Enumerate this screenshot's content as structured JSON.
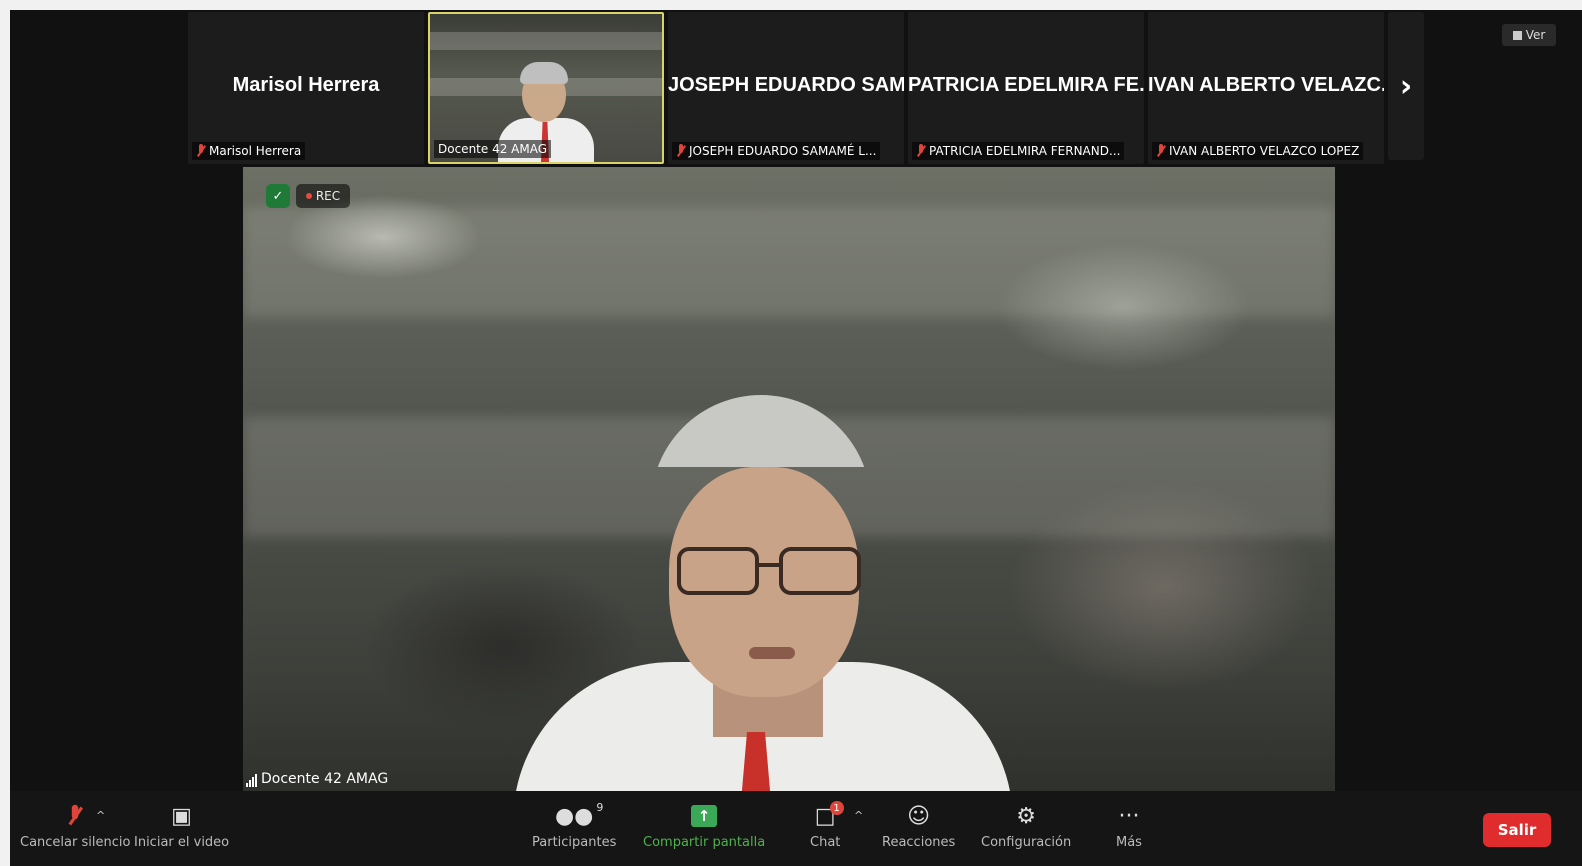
{
  "participants_strip": [
    {
      "display_name": "Marisol Herrera",
      "label": "Marisol Herrera",
      "has_video": false
    },
    {
      "display_name": "",
      "label": "Docente 42 AMAG",
      "has_video": true,
      "active_speaker": true
    },
    {
      "display_name": "JOSEPH EDUARDO SAM...",
      "label": "JOSEPH EDUARDO SAMAMÉ L...",
      "has_video": false
    },
    {
      "display_name": "PATRICIA EDELMIRA FE...",
      "label": "PATRICIA EDELMIRA FERNAND...",
      "has_video": false
    },
    {
      "display_name": "IVAN ALBERTO VELAZC...",
      "label": "IVAN ALBERTO VELAZCO LOPEZ",
      "has_video": false
    }
  ],
  "next_page_icon": "chevron-right-icon",
  "view_button": {
    "label": "Ver"
  },
  "main_video": {
    "speaker_label": "Docente 42 AMAG",
    "recording_label": "REC",
    "encryption_icon": "shield-check-icon"
  },
  "toolbar": {
    "mute": {
      "label": "Cancelar silencio",
      "icon": "mic-muted-icon"
    },
    "video": {
      "label": "Iniciar el video",
      "icon": "video-off-icon"
    },
    "participants": {
      "label": "Participantes",
      "count": "9",
      "icon": "participants-icon"
    },
    "share": {
      "label": "Compartir pantalla",
      "icon": "share-screen-icon"
    },
    "chat": {
      "label": "Chat",
      "badge": "1",
      "icon": "chat-icon"
    },
    "reactions": {
      "label": "Reacciones",
      "icon": "reactions-icon"
    },
    "settings": {
      "label": "Configuración",
      "icon": "gear-icon"
    },
    "more": {
      "label": "Más",
      "icon": "more-icon"
    },
    "leave": {
      "label": "Salir"
    }
  },
  "colors": {
    "leave": "#e02c2c",
    "share": "#3aa856",
    "active_border": "#d8d36a",
    "muted": "#e0453b"
  }
}
